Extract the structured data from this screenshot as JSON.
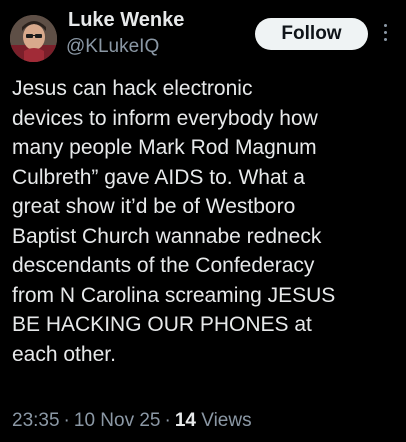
{
  "author": {
    "display_name": "Luke Wenke",
    "handle": "@KLukeIQ"
  },
  "actions": {
    "follow_label": "Follow",
    "more_icon": "more-vertical-icon"
  },
  "tweet": {
    "text": "Jesus can hack electronic\ndevices to inform everybody how\nmany people Mark Rod Magnum\nCulbreth” gave AIDS to.  What a\ngreat show it’d be of Westboro\nBaptist Church wannabe redneck\ndescendants of the Confederacy\nfrom N Carolina screaming JESUS\nBE HACKING OUR PHONES at\neach other."
  },
  "meta": {
    "time": "23:35",
    "separator": "·",
    "date": "10 Nov 25",
    "views_count": "14",
    "views_label": "Views"
  },
  "colors": {
    "background": "#000000",
    "primary_text": "#e7e9ea",
    "secondary_text": "#8b98a5",
    "follow_bg": "#eff3f4",
    "follow_text": "#0f1419"
  }
}
